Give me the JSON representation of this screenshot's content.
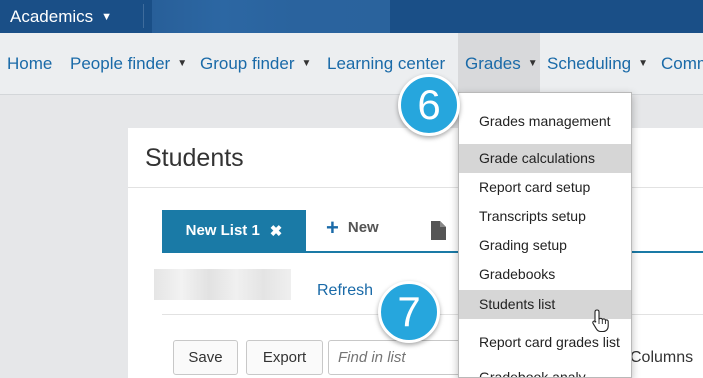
{
  "topbar": {
    "app_name": "Academics"
  },
  "nav": {
    "items": [
      {
        "label": "Home",
        "has_caret": false
      },
      {
        "label": "People finder",
        "has_caret": true
      },
      {
        "label": "Group finder",
        "has_caret": true
      },
      {
        "label": "Learning center",
        "has_caret": false
      },
      {
        "label": "Grades",
        "has_caret": true,
        "active": true
      },
      {
        "label": "Scheduling",
        "has_caret": true
      },
      {
        "label": "Comm",
        "has_caret": false
      }
    ]
  },
  "panel": {
    "title": "Students",
    "tab_label": "New List 1",
    "new_label": "New",
    "refresh_label": "Refresh",
    "save_label": "Save",
    "export_label": "Export",
    "find_placeholder": "Find in list",
    "columns_label": "Columns"
  },
  "grades_menu": {
    "items": [
      "Grades management",
      "Grade calculations",
      "Report card setup",
      "Transcripts setup",
      "Grading setup",
      "Gradebooks",
      "Students list",
      "Report card grades list",
      "Gradebook analy"
    ],
    "highlighted": [
      "Grade calculations",
      "Students list"
    ]
  },
  "callouts": {
    "step_a": "6",
    "step_b": "7"
  },
  "colors": {
    "topbar": "#1a4f87",
    "link": "#1a6aa8",
    "tab_active": "#1a7aa6",
    "badge": "#26a6dd"
  }
}
